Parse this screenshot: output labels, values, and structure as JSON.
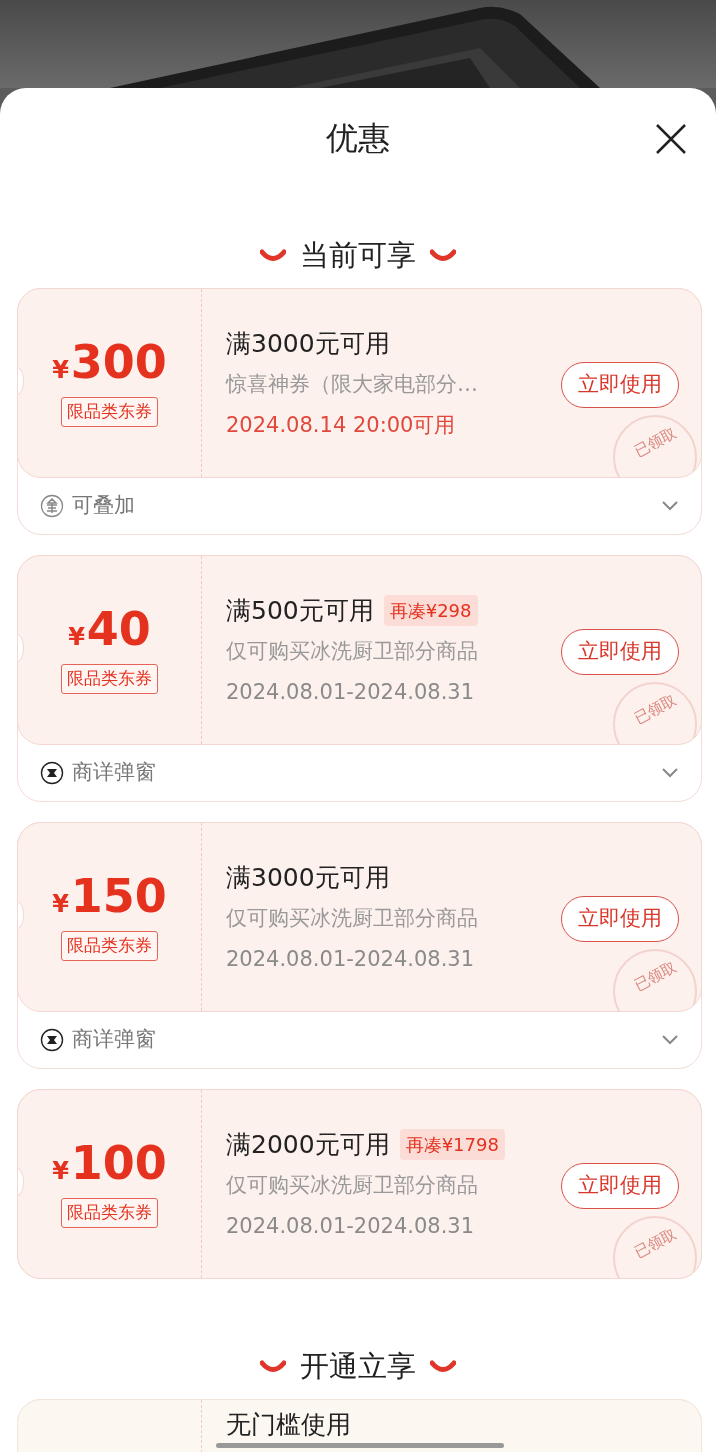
{
  "sheet": {
    "title": "优惠"
  },
  "sections": [
    {
      "title": "当前可享",
      "coupons": [
        {
          "currency": "¥",
          "amount": "300",
          "tag": "限品类东券",
          "title": "满3000元可用",
          "desc": "惊喜神券（限大家电部分…",
          "date": "2024.08.14 20:00可用",
          "date_highlight": true,
          "button": "立即使用",
          "stamp": "已领取",
          "footer": {
            "kind": "stack",
            "text": "可叠加"
          }
        },
        {
          "currency": "¥",
          "amount": "40",
          "tag": "限品类东券",
          "title": "满500元可用",
          "extra": "再凑¥298",
          "desc": "仅可购买冰洗厨卫部分商品",
          "date": "2024.08.01-2024.08.31",
          "date_highlight": false,
          "button": "立即使用",
          "stamp": "已领取",
          "footer": {
            "kind": "popup",
            "text": "商详弹窗"
          }
        },
        {
          "currency": "¥",
          "amount": "150",
          "tag": "限品类东券",
          "title": "满3000元可用",
          "desc": "仅可购买冰洗厨卫部分商品",
          "date": "2024.08.01-2024.08.31",
          "date_highlight": false,
          "button": "立即使用",
          "stamp": "已领取",
          "footer": {
            "kind": "popup",
            "text": "商详弹窗"
          }
        },
        {
          "currency": "¥",
          "amount": "100",
          "tag": "限品类东券",
          "title": "满2000元可用",
          "extra": "再凑¥1798",
          "desc": "仅可购买冰洗厨卫部分商品",
          "date": "2024.08.01-2024.08.31",
          "date_highlight": false,
          "button": "立即使用",
          "stamp": "已领取"
        }
      ]
    },
    {
      "title": "开通立享",
      "coupons": [
        {
          "title": "无门槛使用"
        }
      ]
    }
  ]
}
